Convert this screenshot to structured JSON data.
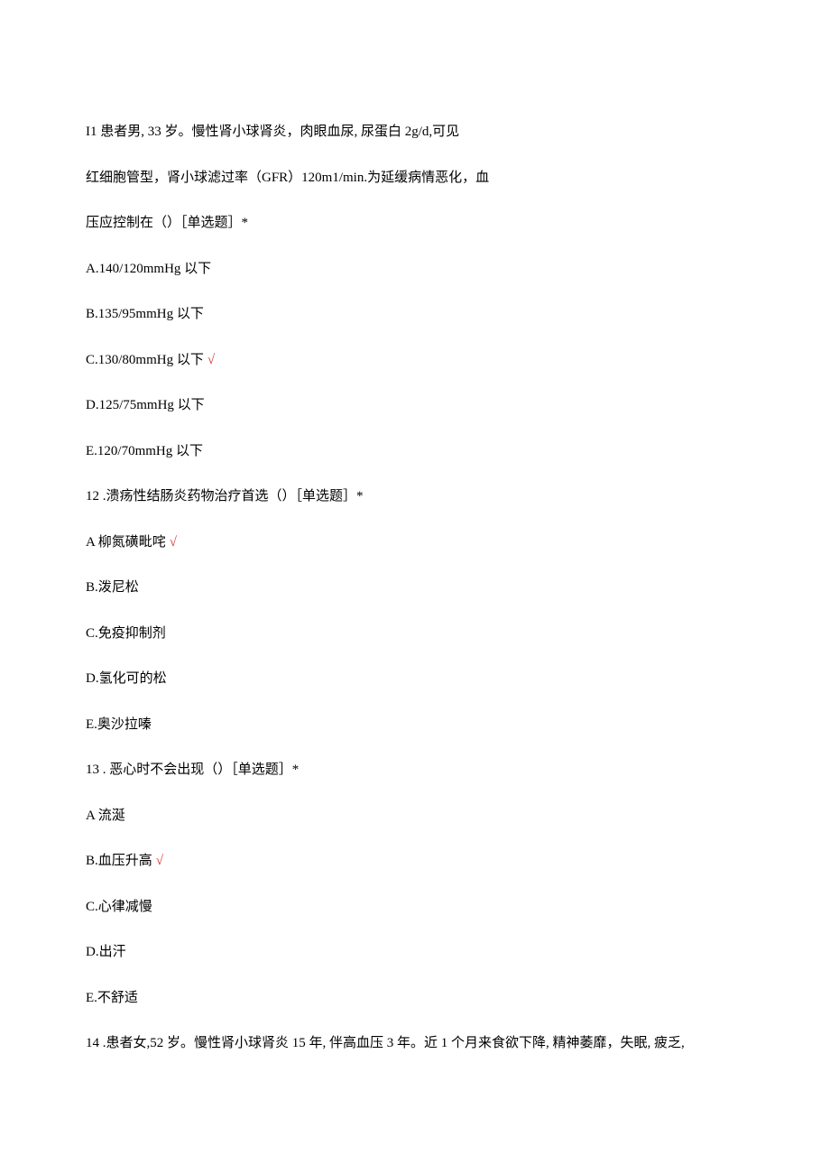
{
  "questions": [
    {
      "stem_lines": [
        "I1 患者男, 33 岁。慢性肾小球肾炎，肉眼血尿, 尿蛋白 2g/d,可见",
        "红细胞管型，肾小球滤过率（GFR）120m1/min.为延缓病情恶化，血",
        "压应控制在（）［单选题］*"
      ],
      "options": [
        {
          "text": "A.140/120mmHg 以下",
          "correct": false
        },
        {
          "text": "B.135/95mmHg 以下",
          "correct": false
        },
        {
          "text": "C.130/80mmHg 以下",
          "correct": true
        },
        {
          "text": "D.125/75mmHg 以下",
          "correct": false
        },
        {
          "text": "E.120/70mmHg 以下",
          "correct": false
        }
      ]
    },
    {
      "stem_lines": [
        "12   .溃疡性结肠炎药物治疗首选（）［单选题］*"
      ],
      "options": [
        {
          "text": "A 柳氮磺毗咤",
          "correct": true
        },
        {
          "text": "B.泼尼松",
          "correct": false
        },
        {
          "text": "C.免疫抑制剂",
          "correct": false
        },
        {
          "text": "D.氢化可的松",
          "correct": false
        },
        {
          "text": "E.奥沙拉嗪",
          "correct": false
        }
      ]
    },
    {
      "stem_lines": [
        "13   . 恶心时不会出现（）［单选题］*"
      ],
      "options": [
        {
          "text": "A 流涎",
          "correct": false
        },
        {
          "text": "B.血压升高",
          "correct": true
        },
        {
          "text": "C.心律减慢",
          "correct": false
        },
        {
          "text": "D.出汗",
          "correct": false
        },
        {
          "text": "E.不舒适",
          "correct": false
        }
      ]
    },
    {
      "stem_lines": [
        "14   .患者女,52 岁。慢性肾小球肾炎 15 年, 伴高血压 3 年。近 1 个月来食欲下降, 精神萎靡，失眠, 疲乏,"
      ],
      "options": []
    }
  ],
  "check_mark": "√"
}
